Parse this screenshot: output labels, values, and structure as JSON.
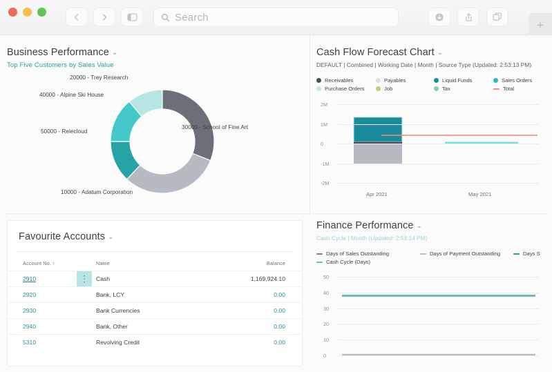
{
  "browser": {
    "traffic_lights": [
      "close",
      "minimize",
      "maximize"
    ],
    "back_label": "Back",
    "forward_label": "Forward",
    "sidebar_label": "Show Sidebar",
    "search_placeholder": "Search",
    "downloads_label": "Downloads",
    "share_label": "Share",
    "tabs_label": "Tab Overview",
    "new_tab_label": "+"
  },
  "business_performance": {
    "title": "Business Performance",
    "subtitle": "Top Five Customers by Sales Value",
    "chevron": "⌄"
  },
  "cash_flow": {
    "title": "Cash Flow Forecast Chart",
    "subtitle": "DEFAULT | Combined | Working Date | Month | Source Type (Updated:  2:53:13 PM)",
    "chevron": "⌄",
    "legend": [
      {
        "label": "Receivables",
        "color": "#4a4f57",
        "type": "dot"
      },
      {
        "label": "Payables",
        "color": "#dfe1e3",
        "type": "dot"
      },
      {
        "label": "Liquid Funds",
        "color": "#1a8a9c",
        "type": "dot"
      },
      {
        "label": "Sales Orders",
        "color": "#2bb8c4",
        "type": "dot"
      },
      {
        "label": "Purchase Orders",
        "color": "#bfe9e6",
        "type": "dot"
      },
      {
        "label": "Job",
        "color": "#c3cf76",
        "type": "dot"
      },
      {
        "label": "Tax",
        "color": "#86cfa6",
        "type": "dot"
      },
      {
        "label": "Total",
        "color": "#f08a7c",
        "type": "line"
      }
    ]
  },
  "favourite_accounts": {
    "title": "Favourite Accounts",
    "chevron": "⌄",
    "columns": [
      "Account No. ↑",
      "Name",
      "Balance"
    ],
    "dots_glyph": "⋮",
    "rows": [
      {
        "account_no": "2910",
        "name": "Cash",
        "balance": "1,169,924.10",
        "selected": true
      },
      {
        "account_no": "2920",
        "name": "Bank, LCY",
        "balance": "0.00",
        "selected": false
      },
      {
        "account_no": "2930",
        "name": "Bank Currencies",
        "balance": "0.00",
        "selected": false
      },
      {
        "account_no": "2940",
        "name": "Bank, Other",
        "balance": "0.00",
        "selected": false
      },
      {
        "account_no": "5310",
        "name": "Revolving Credit",
        "balance": "0.00",
        "selected": false
      }
    ]
  },
  "finance_performance": {
    "title": "Finance Performance",
    "subtitle": "Cash Cycle | Month (Updated:  2:53:14 PM)",
    "chevron": "⌄",
    "legend": [
      {
        "label": "Days of Sales Outstanding",
        "color": "#7f8184"
      },
      {
        "label": "Days of Payment Outstanding",
        "color": "#b9bcbf"
      },
      {
        "label": "Days S",
        "color": "#2a9ba8"
      },
      {
        "label": "Cash Cycle (Days)",
        "color": "#4ec3c9"
      }
    ]
  },
  "chart_data": [
    {
      "type": "pie",
      "title": "Top Five Customers by Sales Value",
      "legend_position": "labels-outside",
      "categories": [
        "30000 - School of Fine Art",
        "10000 - Adatum Corporation",
        "50000 - Relecloud",
        "40000 - Alpine Ski House",
        "20000 - Trey Research"
      ],
      "values": [
        31,
        31,
        13,
        14,
        11
      ],
      "colors": [
        "#6b7078",
        "#b6bac1",
        "#27a3a8",
        "#44c8c9",
        "#b6e5e6"
      ]
    },
    {
      "type": "bar",
      "title": "Cash Flow Forecast Chart",
      "xlabel": "",
      "ylabel": "",
      "categories": [
        "Apr 2021",
        "May 2021"
      ],
      "ylim": [
        -2000000,
        2000000
      ],
      "ytick_labels": [
        "2M",
        "1M",
        "0",
        "-1M",
        "-2M"
      ],
      "ytick_values": [
        2000000,
        1000000,
        0,
        -1000000,
        -2000000
      ],
      "grid": true,
      "series": [
        {
          "name": "Liquid Funds",
          "color": "#1a8a9c",
          "values": [
            1250000,
            0
          ]
        },
        {
          "name": "Receivables",
          "color": "#4a4f57",
          "values": [
            90000,
            0
          ]
        },
        {
          "name": "Payables",
          "color": "#b6bac1",
          "values": [
            -1020000,
            0
          ]
        },
        {
          "name": "Sales Orders",
          "color": "#7fd9e6",
          "values": [
            0,
            20000
          ]
        },
        {
          "name": "Total",
          "color": "#f08a7c",
          "type": "line",
          "values": [
            420000,
            420000
          ]
        }
      ]
    },
    {
      "type": "line",
      "title": "Finance Performance",
      "subtitle": "Cash Cycle | Month",
      "xlabel": "",
      "ylabel": "",
      "ylim": [
        0,
        50
      ],
      "ytick_labels": [
        "50",
        "40",
        "30",
        "20",
        "10",
        "0"
      ],
      "ytick_values": [
        50,
        40,
        30,
        20,
        10,
        0
      ],
      "grid": true,
      "series": [
        {
          "name": "Days of Sales Outstanding",
          "color": "#7f8184",
          "values": [
            38,
            38,
            38,
            38
          ]
        },
        {
          "name": "Days of Payment Outstanding",
          "color": "#b9bcbf",
          "values": [
            0.5,
            0.5,
            0.5,
            0.5
          ]
        },
        {
          "name": "Days S",
          "color": "#2a9ba8",
          "values": [
            38,
            38,
            38,
            38
          ]
        },
        {
          "name": "Cash Cycle (Days)",
          "color": "#4ec3c9",
          "values": [
            38,
            38,
            38,
            38
          ]
        }
      ]
    }
  ]
}
